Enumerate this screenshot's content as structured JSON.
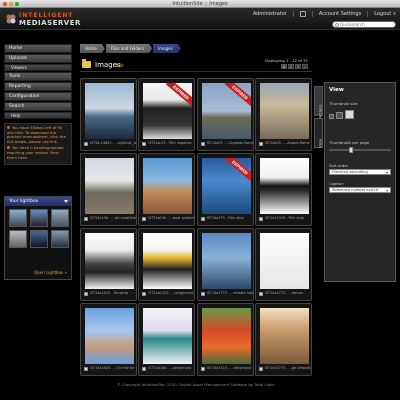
{
  "window": {
    "title": "IntuitionSite :: Images"
  },
  "header": {
    "logo_line1": "INTELLIGENT",
    "logo_line2": "MEDIASERVER",
    "user": "Administrator",
    "account_settings": "Account Settings",
    "logout": "Logout »",
    "search_placeholder": "Quicksearch"
  },
  "sidebar": {
    "items": [
      "Home",
      "Uploads",
      "Viewers",
      "Tools",
      "Reporting",
      "Configuration",
      "Search",
      "Help"
    ],
    "notices": [
      "You have 55days left of 90 day trial. To download the product manualsheet, click the link below, please use link.",
      "You have 0 pending/upload requiring your review. View them here."
    ],
    "lightbox": {
      "title": "Your lightbox",
      "open_link": "Open Lightbox »"
    }
  },
  "breadcrumb": [
    "Home",
    "Files and Folders",
    "Images"
  ],
  "main": {
    "title": "Images",
    "edit": "Edit",
    "display_info": "Displaying 1 - 12 of 31",
    "pages": [
      "1",
      "2",
      "3",
      "»"
    ],
    "current_page": "1"
  },
  "tiles": [
    {
      "caption": "IST14-13651 - ...ngland1_low",
      "expired": false,
      "theme": "coast"
    },
    {
      "caption": "IST14a-23 - Film negative",
      "expired": true,
      "theme": "camera"
    },
    {
      "caption": "IST14a03 - ...Angkota Rome",
      "expired": true,
      "theme": "bridge"
    },
    {
      "caption": "IST14a03 - ...Angels Rome",
      "expired": false,
      "theme": "angels"
    },
    {
      "caption": "IST14a13b - ...ish coastline",
      "expired": false,
      "theme": "shore"
    },
    {
      "caption": "IST14a13b - ...boat platform",
      "expired": false,
      "theme": "deck"
    },
    {
      "caption": "IST14a273 - Film strip",
      "expired": true,
      "theme": "sea"
    },
    {
      "caption": "IST14a1019 - Film strip",
      "expired": false,
      "theme": "filmstrip"
    },
    {
      "caption": "IST14a1019 - Filmstrip",
      "expired": false,
      "theme": "film"
    },
    {
      "caption": "IST14a1102 - ...ackground",
      "expired": false,
      "theme": "roll"
    },
    {
      "caption": "IST14a2773 - ...erreate hotel",
      "expired": false,
      "theme": "building"
    },
    {
      "caption": "IST14a2773 - ...atrium",
      "expired": false,
      "theme": "blank"
    },
    {
      "caption": "IST14a1424 - ...t in the air",
      "expired": false,
      "theme": "hands"
    },
    {
      "caption": "IST14a14b - ...ackground",
      "expired": false,
      "theme": "hummingbird"
    },
    {
      "caption": "IST14a2114 - ...ackground",
      "expired": false,
      "theme": "flower"
    },
    {
      "caption": "IST14a2773 - ...ge Umbrella",
      "expired": false,
      "theme": "stairs"
    }
  ],
  "panel": {
    "tabs": [
      "Actions",
      "View"
    ],
    "title": "View",
    "thumb_size_label": "Thumbnail size",
    "per_page_label": "Thumbnails per page",
    "sort_label": "Sort order",
    "sort_value": "Filename ascending",
    "caption_label": "Caption",
    "caption_value": "Reference number and tit"
  },
  "footer": "© Copyright IntuitionSite. 2010. Digital Asset Management Software by Total Light."
}
